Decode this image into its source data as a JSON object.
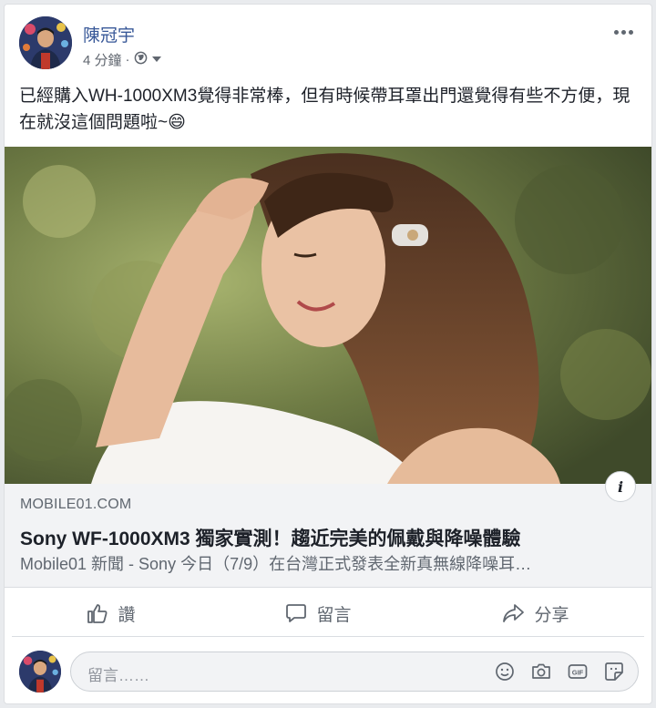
{
  "post": {
    "author": "陳冠宇",
    "time": "4 分鐘",
    "separator": "·",
    "text": "已經購入WH-1000XM3覺得非常棒，但有時候帶耳罩出門還覺得有些不方便，現在就沒這個問題啦~😄"
  },
  "link": {
    "domain": "MOBILE01.COM",
    "title": "Sony WF-1000XM3 獨家實測！趨近完美的佩戴與降噪體驗",
    "description": "Mobile01 新聞 - Sony 今日（7/9）在台灣正式發表全新真無線降噪耳…",
    "info": "i"
  },
  "actions": {
    "like": "讚",
    "comment": "留言",
    "share": "分享"
  },
  "comment_input": {
    "placeholder": "留言……"
  },
  "icons": {
    "globe": "globe-icon",
    "dropdown": "caret-down-icon",
    "like": "thumbs-up-icon",
    "comment": "speech-bubble-icon",
    "share": "share-arrow-icon",
    "emoji": "smiley-icon",
    "camera": "camera-icon",
    "gif": "gif-icon",
    "sticker": "sticker-icon"
  },
  "colors": {
    "author_link": "#385898",
    "secondary_text": "#606770",
    "link_bg": "#f2f3f5"
  }
}
